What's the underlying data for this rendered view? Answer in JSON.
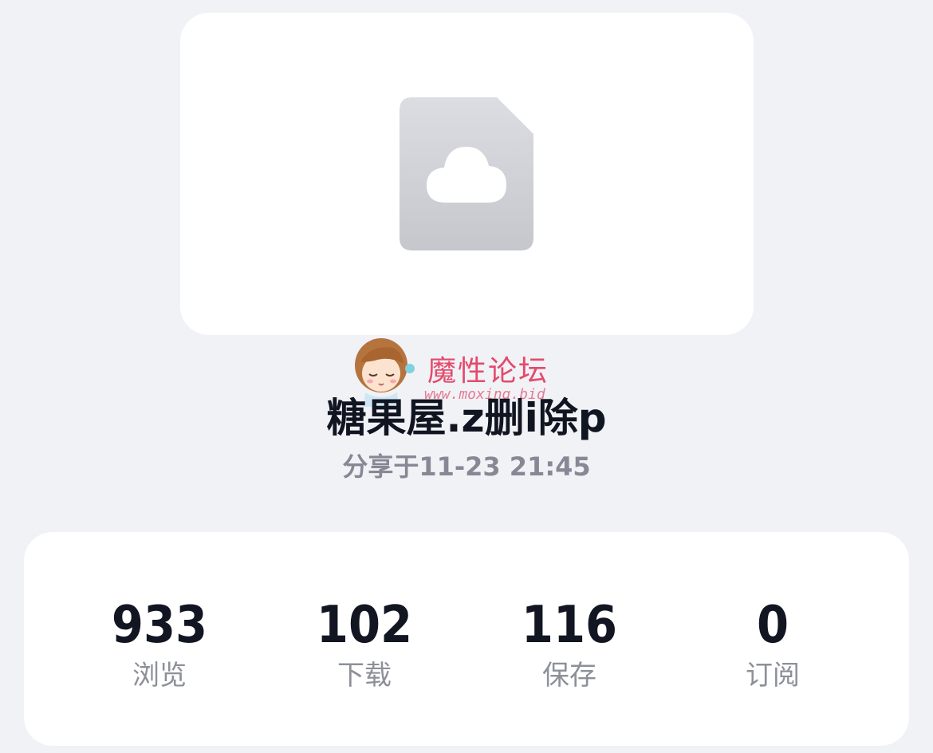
{
  "file": {
    "name": "糖果屋.z删i除p",
    "shared_at": "分享于11-23 21:45",
    "icon": "cloud-file-icon"
  },
  "watermark": {
    "title": "魔性论坛",
    "url": "www.moxing.bid"
  },
  "stats": [
    {
      "value": "933",
      "label": "浏览"
    },
    {
      "value": "102",
      "label": "下载"
    },
    {
      "value": "116",
      "label": "保存"
    },
    {
      "value": "0",
      "label": "订阅"
    }
  ],
  "colors": {
    "background": "#f0f2f6",
    "card": "#ffffff",
    "title_text": "#111522",
    "muted_text": "#868994",
    "watermark": "#e44a6b"
  }
}
